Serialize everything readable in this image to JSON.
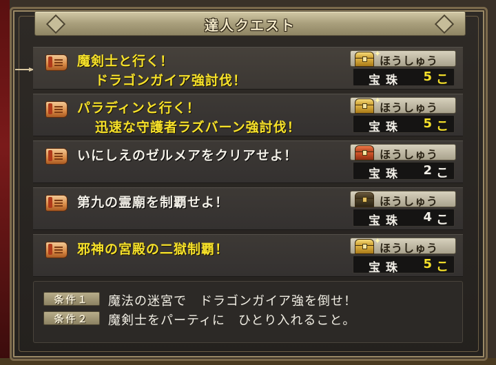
{
  "window": {
    "title": "達人クエスト"
  },
  "colors": {
    "quest_yellow": "#f6e12a",
    "quest_white": "#f3f0e8",
    "count_yellow": "#f6e12a",
    "count_white": "#f3f0e8"
  },
  "quests": [
    {
      "lines": [
        "魔剣士と行く！",
        "ドラゴンガイア強討伐！"
      ],
      "color": "yellow",
      "chest": "gold",
      "reward": {
        "label": "ほうしゅう",
        "name": "宝珠",
        "count": "5",
        "unit": "こ"
      },
      "selected": true
    },
    {
      "lines": [
        "パラディンと行く！",
        "迅速な守護者ラズバーン強討伐！"
      ],
      "color": "yellow",
      "chest": "gold",
      "reward": {
        "label": "ほうしゅう",
        "name": "宝珠",
        "count": "5",
        "unit": "こ"
      }
    },
    {
      "lines": [
        "いにしえのゼルメアをクリアせよ！"
      ],
      "color": "white",
      "chest": "red",
      "reward": {
        "label": "ほうしゅう",
        "name": "宝珠",
        "count": "2",
        "unit": "こ"
      }
    },
    {
      "lines": [
        "第九の霊廟を制覇せよ！"
      ],
      "color": "white",
      "chest": "dark",
      "reward": {
        "label": "ほうしゅう",
        "name": "宝珠",
        "count": "4",
        "unit": "こ"
      }
    },
    {
      "lines": [
        "邪神の宮殿の二獄制覇！"
      ],
      "color": "yellow",
      "chest": "gold",
      "reward": {
        "label": "ほうしゅう",
        "name": "宝珠",
        "count": "5",
        "unit": "こ"
      }
    }
  ],
  "conditions": [
    {
      "badge": "条件１",
      "text": "魔法の迷宮で　ドラゴンガイア強を倒せ！"
    },
    {
      "badge": "条件２",
      "text": "魔剣士をパーティに　ひとり入れること。"
    }
  ],
  "icons": {
    "quest": "scroll-icon",
    "reward": "treasure-chest-icon",
    "cursor": "pointer-cursor-icon"
  }
}
